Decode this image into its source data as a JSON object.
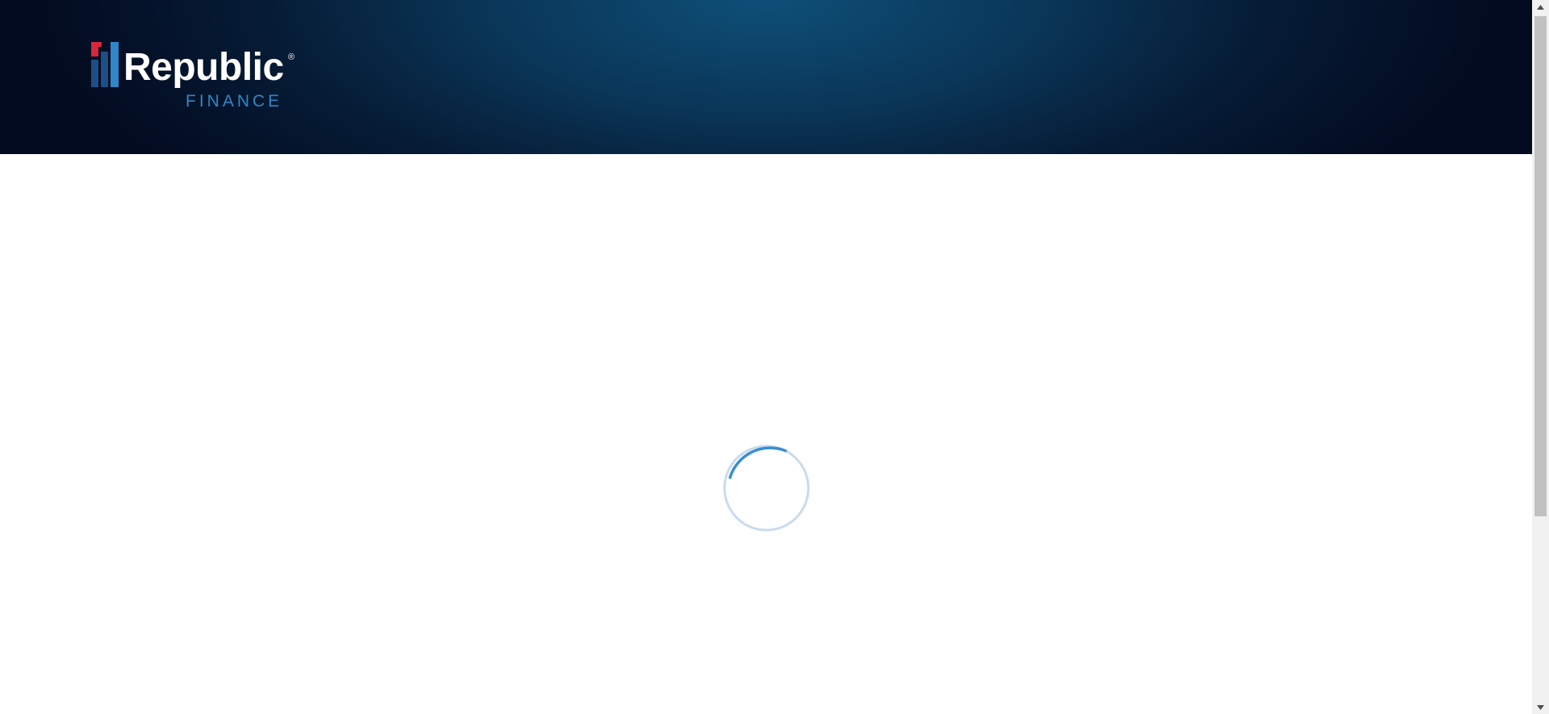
{
  "header": {
    "logo": {
      "wordmark": "Republic",
      "registered": "®",
      "subtitle": "FINANCE"
    },
    "background_colors": [
      "#0e4f78",
      "#030b20"
    ]
  },
  "brand_colors": {
    "red": "#d7263d",
    "dark_blue": "#1d4f86",
    "light_blue": "#2f86c8",
    "text_white": "#ffffff"
  },
  "main": {
    "status": "loading",
    "spinner": {
      "icon": "loading-spinner-icon",
      "arc_color": "#3a8fd0",
      "track_color": "#c9dbee"
    }
  },
  "scrollbar": {
    "up_icon": "arrow-up-icon",
    "down_icon": "arrow-down-icon"
  }
}
